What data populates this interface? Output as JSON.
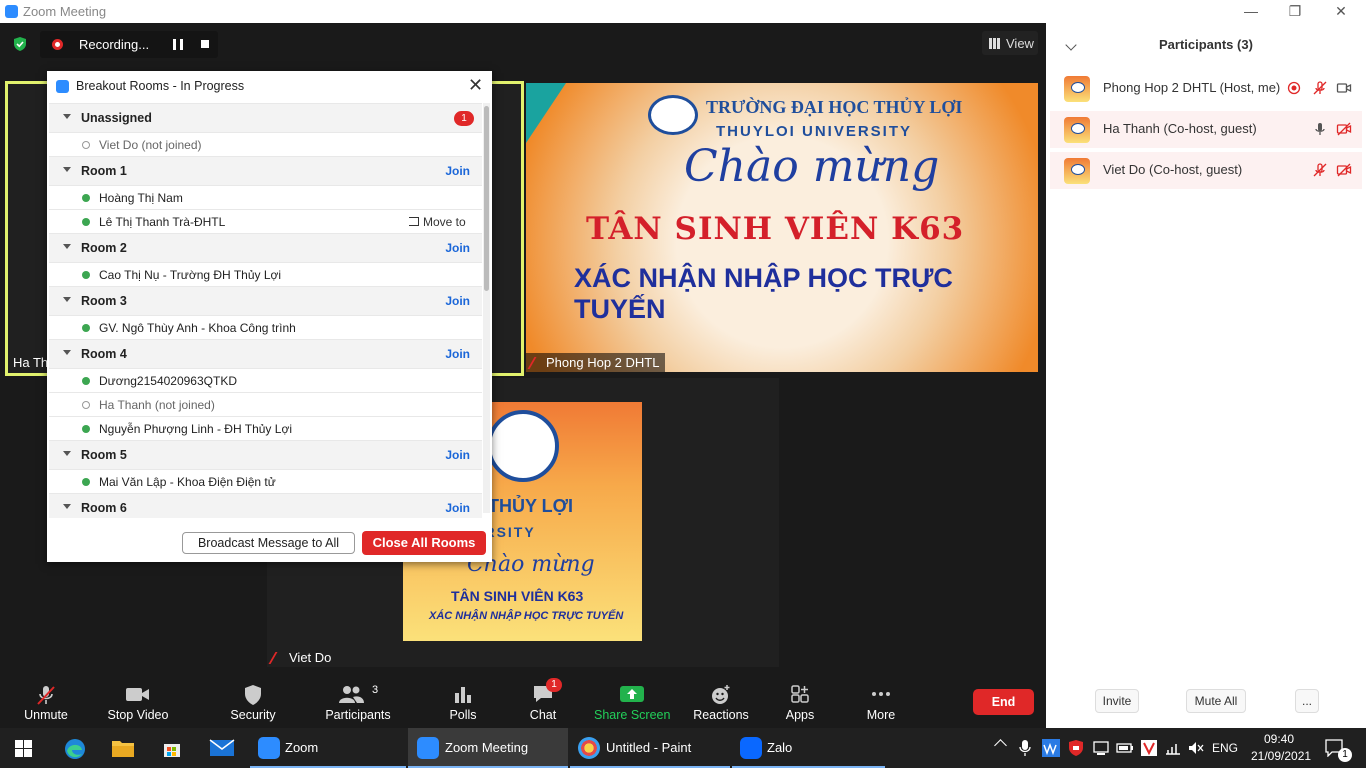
{
  "window": {
    "title": "Zoom Meeting",
    "minimize": "—",
    "restore": "❐",
    "close": "✕"
  },
  "recording": {
    "label": "Recording..."
  },
  "view_button": {
    "label": "View"
  },
  "tiles": {
    "left_name": "Ha Th",
    "main_name": "Phong Hop 2 DHTL",
    "bottom_name": "Viet Do"
  },
  "banner": {
    "university_vi": "TRƯỜNG ĐẠI HỌC THỦY LỢI",
    "university_en": "THUYLOI UNIVERSITY",
    "greeting": "Chào mừng",
    "headline": "TÂN SINH VIÊN K63",
    "subline": "XÁC NHẬN NHẬP HỌC TRỰC TUYẾN"
  },
  "poster": {
    "university_vi": "ĐẠI HỌC THỦY LỢI",
    "university_en": "OI UNIVERSITY",
    "greeting": "Chào mừng",
    "headline": "TÂN SINH VIÊN K63",
    "subline": "XÁC NHẬN NHẬP HỌC TRỰC TUYẾN"
  },
  "breakout": {
    "title": "Breakout Rooms - In Progress",
    "join_label": "Join",
    "move_to_label": "Move to",
    "groups": [
      {
        "name": "Unassigned",
        "badge": "1",
        "members": [
          {
            "name": "Viet Do (not joined)",
            "joined": false
          }
        ]
      },
      {
        "name": "Room 1",
        "members": [
          {
            "name": "Hoàng Thị Nam",
            "joined": true
          },
          {
            "name": "Lê Thị Thanh Trà-ĐHTL",
            "joined": true
          }
        ]
      },
      {
        "name": "Room 2",
        "members": [
          {
            "name": "Cao Thị Nụ - Trường ĐH Thủy Lợi",
            "joined": true
          }
        ]
      },
      {
        "name": "Room 3",
        "members": [
          {
            "name": "GV. Ngô Thùy Anh - Khoa Công trình",
            "joined": true
          }
        ]
      },
      {
        "name": "Room 4",
        "members": [
          {
            "name": "Dương2154020963QTKD",
            "joined": true
          },
          {
            "name": "Ha Thanh (not joined)",
            "joined": false
          },
          {
            "name": "Nguyễn Phượng Linh - ĐH Thủy Lợi",
            "joined": true
          }
        ]
      },
      {
        "name": "Room 5",
        "members": [
          {
            "name": "Mai Văn Lập - Khoa Điện Điện tử",
            "joined": true
          }
        ]
      },
      {
        "name": "Room 6",
        "members": []
      }
    ],
    "broadcast_label": "Broadcast Message to All",
    "close_all_label": "Close All Rooms"
  },
  "participants": {
    "header": "Participants (3)",
    "list": [
      {
        "name": "Phong Hop 2 DHTL (Host, me)"
      },
      {
        "name": "Ha Thanh (Co-host, guest)"
      },
      {
        "name": "Viet Do (Co-host, guest)"
      }
    ],
    "invite": "Invite",
    "mute_all": "Mute All",
    "more": "..."
  },
  "toolbar": {
    "unmute": "Unmute",
    "stop_video": "Stop Video",
    "security": "Security",
    "participants": "Participants",
    "participants_count": "3",
    "polls": "Polls",
    "chat": "Chat",
    "chat_badge": "1",
    "share_screen": "Share Screen",
    "reactions": "Reactions",
    "apps": "Apps",
    "more": "More",
    "end": "End"
  },
  "taskbar": {
    "apps": [
      "Zoom",
      "Zoom Meeting",
      "Untitled - Paint",
      "Zalo"
    ],
    "lang": "ENG",
    "time": "09:40",
    "date": "21/09/2021",
    "notif_badge": "1"
  },
  "colors": {
    "accent": "#2d8cff",
    "danger": "#e02828",
    "share_green": "#22b24c",
    "highlight_border": "#e2f26d"
  }
}
